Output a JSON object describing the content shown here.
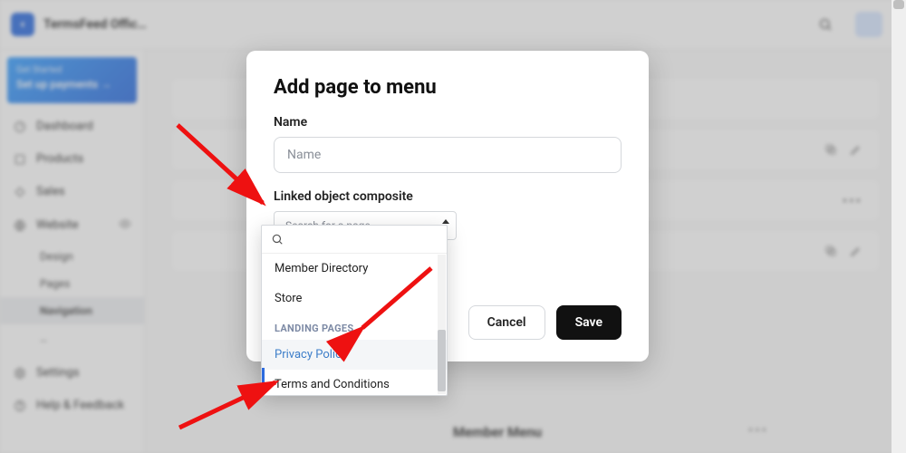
{
  "topbar": {
    "app_title": "TermsFeed Office…"
  },
  "banner": {
    "line1": "Get Started",
    "line2": "Set up payments →"
  },
  "sidebar": {
    "dashboard": "Dashboard",
    "products": "Products",
    "sales": "Sales",
    "website": "Website",
    "sub_design": "Design",
    "sub_pages": "Pages",
    "sub_navigation": "Navigation",
    "sub_more": "…",
    "settings": "Settings",
    "help": "Help & Feedback"
  },
  "modal": {
    "title": "Add page to menu",
    "name_label": "Name",
    "name_placeholder": "Name",
    "linked_label": "Linked object composite",
    "combo_placeholder": "Search for a page",
    "cancel": "Cancel",
    "save": "Save"
  },
  "dropdown": {
    "member_directory": "Member Directory",
    "store": "Store",
    "landing_header": "LANDING PAGES",
    "privacy_policy": "Privacy Policy",
    "terms": "Terms and Conditions"
  },
  "bg": {
    "member_menu": "Member Menu"
  }
}
